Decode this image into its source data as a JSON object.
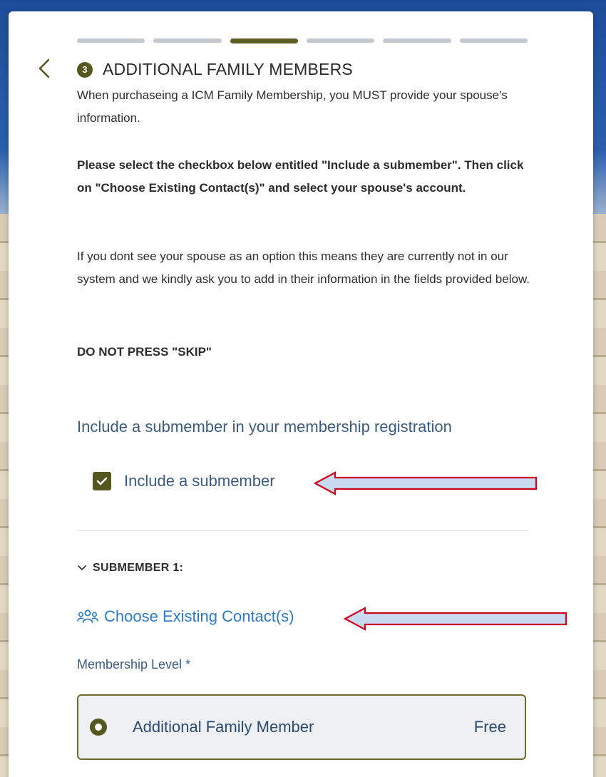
{
  "progress": {
    "total_steps": 6,
    "current_step": 3
  },
  "step": {
    "number": "3",
    "title": "ADDITIONAL FAMILY MEMBERS"
  },
  "instructions": {
    "paragraph1": "When purchaseing a ICM Family Membership, you MUST provide your spouse's information.",
    "paragraph2": "Please select the checkbox below entitled \"Include a submember\".  Then click on \"Choose Existing Contact(s)\" and select your spouse's account.",
    "paragraph3": "If you dont see your spouse as an option this means they are currently not in our system and we kindly ask you to add in their information in the fields provided below.",
    "warning": "DO NOT PRESS \"SKIP\""
  },
  "submember_section": {
    "heading": "Include a submember in your membership registration",
    "checkbox_label": "Include a submember",
    "checkbox_checked": true
  },
  "submember": {
    "label": "SUBMEMBER 1:",
    "expanded": true,
    "choose_contact_label": "Choose Existing Contact(s)",
    "level_label": "Membership Level *",
    "option": {
      "name": "Additional Family Member",
      "price": "Free",
      "selected": true
    }
  },
  "colors": {
    "accent": "#56571e",
    "link": "#2e7bc1",
    "heading_blue": "#3c5c7e",
    "arrow_fill": "#c7daf0",
    "arrow_stroke": "#d0021b"
  },
  "icons": {
    "back": "chevron-left-icon",
    "expand": "chevron-down-icon",
    "contacts": "people-group-icon",
    "check": "check-icon"
  }
}
